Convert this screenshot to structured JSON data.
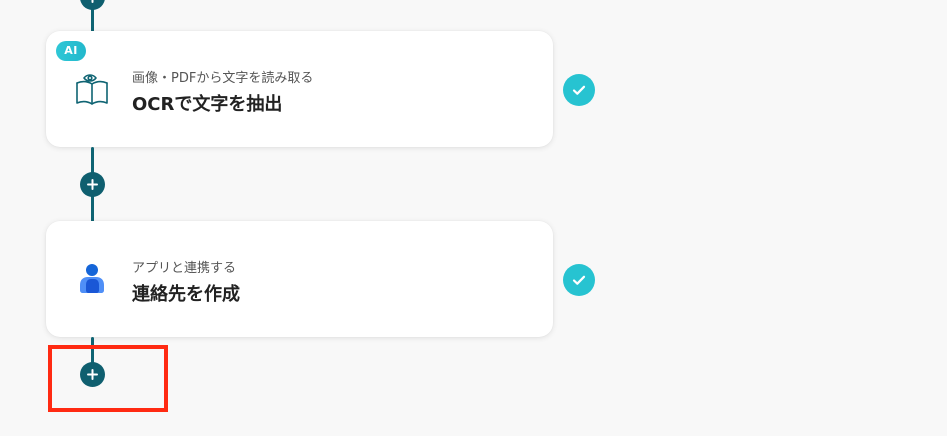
{
  "flow": {
    "steps": [
      {
        "badge": "AI",
        "icon": "ocr-book-eye-icon",
        "subtitle": "画像・PDFから文字を読み取る",
        "title": "OCRで文字を抽出",
        "status": "completed"
      },
      {
        "icon": "person-contact-icon",
        "subtitle": "アプリと連携する",
        "title": "連絡先を作成",
        "status": "completed"
      }
    ]
  },
  "colors": {
    "background": "#f8f8f8",
    "connector": "#0f6473",
    "accent": "#27c3d1",
    "highlight": "#ff2a12"
  }
}
